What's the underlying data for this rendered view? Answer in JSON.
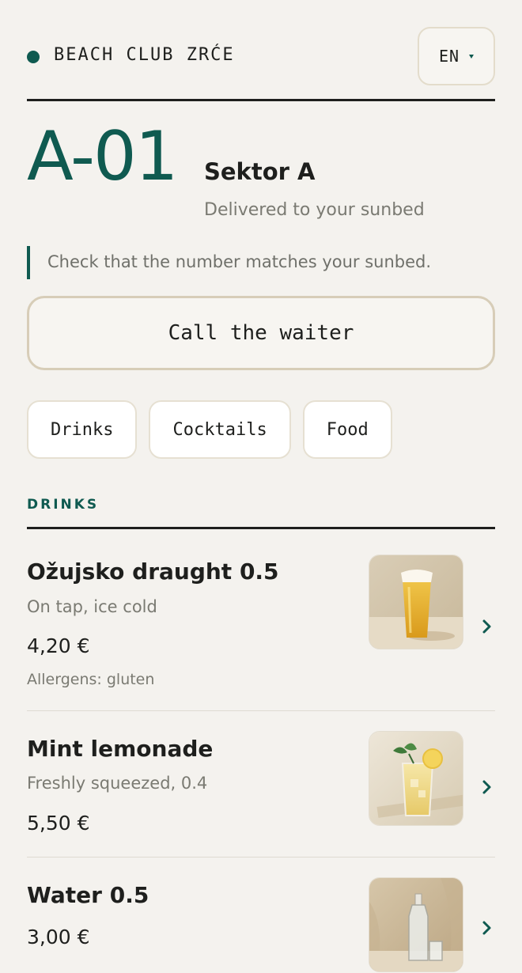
{
  "header": {
    "brand": "BEACH CLUB ZRĆE",
    "language": "EN"
  },
  "sunbed": {
    "number": "A-01",
    "sector": "Sektor A",
    "delivery": "Delivered to your sunbed",
    "notice": "Check that the number matches your sunbed."
  },
  "actions": {
    "call_waiter": "Call the waiter"
  },
  "categories": [
    {
      "label": "Drinks"
    },
    {
      "label": "Cocktails"
    },
    {
      "label": "Food"
    }
  ],
  "section": {
    "title": "DRINKS"
  },
  "items": [
    {
      "name": "Ožujsko draught 0.5",
      "description": "On tap, ice cold",
      "price": "4,20 €",
      "allergens": "Allergens: gluten",
      "image": "beer-glass"
    },
    {
      "name": "Mint lemonade",
      "description": "Freshly squeezed, 0.4",
      "price": "5,50 €",
      "image": "lemonade-glass"
    },
    {
      "name": "Water 0.5",
      "price": "3,00 €",
      "image": "water-bottle"
    }
  ],
  "colors": {
    "accent": "#0f5a50",
    "background": "#f4f2ee",
    "text": "#1e1f1d",
    "muted": "#7a7a72",
    "border": "#d7cdb8"
  },
  "icons": {
    "brand": "status-dot-icon",
    "language": "caret-down-icon",
    "item_action": "chevron-right-icon"
  }
}
